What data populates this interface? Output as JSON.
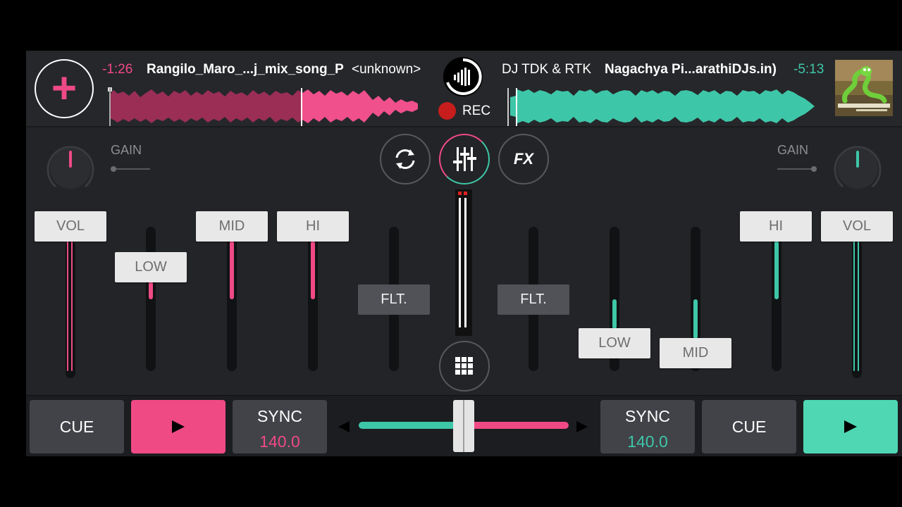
{
  "deck_left": {
    "time": "-1:26",
    "title": "Rangilo_Maro_...j_mix_song_P",
    "artist": "<unknown>",
    "color": "#ef4a84",
    "bpm": "140.0"
  },
  "deck_right": {
    "artist": "DJ TDK & RTK",
    "title": "Nagachya Pi...arathiDJs.in)",
    "time": "-5:13",
    "color": "#3ec6a8",
    "bpm": "140.0",
    "cover_icon": "snake-cover-art"
  },
  "record": {
    "label": "REC"
  },
  "mixer": {
    "gain_label_left": "GAIN",
    "gain_label_right": "GAIN",
    "left": {
      "vol": "VOL",
      "low": "LOW",
      "mid": "MID",
      "hi": "HI",
      "flt": "FLT."
    },
    "right": {
      "vol": "VOL",
      "low": "LOW",
      "mid": "MID",
      "hi": "HI",
      "flt": "FLT."
    },
    "fx_label": "FX"
  },
  "transport": {
    "cue_left": "CUE",
    "sync_left": "SYNC",
    "sync_right": "SYNC",
    "cue_right": "CUE"
  },
  "crossfader_position": 0.5
}
